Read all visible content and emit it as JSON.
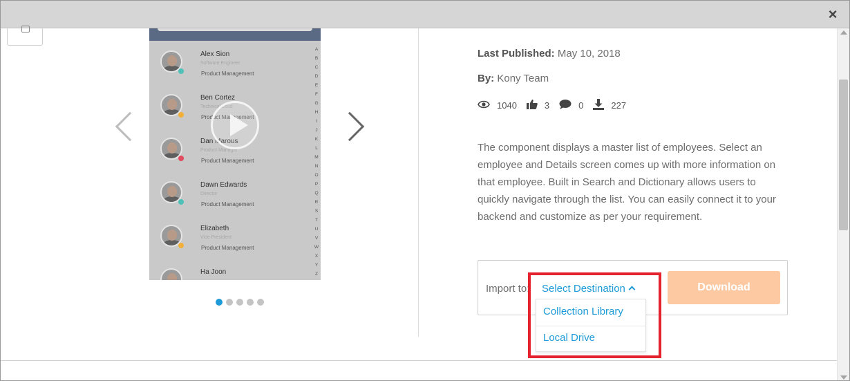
{
  "modal": {
    "close_label": "×"
  },
  "carousel": {
    "contacts": [
      {
        "name": "Alex Sion",
        "role": "Software Engineer",
        "dept": "Product Management",
        "status_color": "#4fc1b8"
      },
      {
        "name": "Ben Cortez",
        "role": "Technical Lead",
        "dept": "Product Management",
        "status_color": "#f2b03a"
      },
      {
        "name": "Dan Marous",
        "role": "Product Manager",
        "dept": "Product Management",
        "status_color": "#e24a5f"
      },
      {
        "name": "Dawn Edwards",
        "role": "Director",
        "dept": "Product Management",
        "status_color": "#4fc1b8"
      },
      {
        "name": "Elizabeth",
        "role": "Vice President",
        "dept": "Product Management",
        "status_color": "#f2b03a"
      },
      {
        "name": "Ha Joon",
        "role": "",
        "dept": "",
        "status_color": "#4fc1b8"
      }
    ],
    "alphabet": [
      "A",
      "B",
      "C",
      "D",
      "E",
      "F",
      "G",
      "H",
      "I",
      "J",
      "K",
      "L",
      "M",
      "N",
      "O",
      "P",
      "Q",
      "R",
      "S",
      "T",
      "U",
      "V",
      "W",
      "X",
      "Y",
      "Z"
    ],
    "dots_total": 5,
    "dots_active_index": 0
  },
  "details": {
    "last_published_label": "Last Published:",
    "last_published_value": "May 10, 2018",
    "by_label": "By:",
    "by_value": "Kony Team",
    "stats": {
      "views": "1040",
      "likes": "3",
      "comments": "0",
      "downloads": "227"
    },
    "description": "The component displays a master list of employees. Select an employee and Details screen comes up with more information on that employee. Built in Search and Dictionary allows users to quickly navigate through the list. You can easily connect it to your backend and customize as per your requirement."
  },
  "import": {
    "label": "Import to:",
    "select_label": "Select Destination",
    "download_label": "Download",
    "options": [
      "Collection Library",
      "Local Drive"
    ]
  },
  "colors": {
    "accent": "#1e9bd7",
    "download_bg": "#fdc9a3",
    "highlight": "#e5232f"
  }
}
